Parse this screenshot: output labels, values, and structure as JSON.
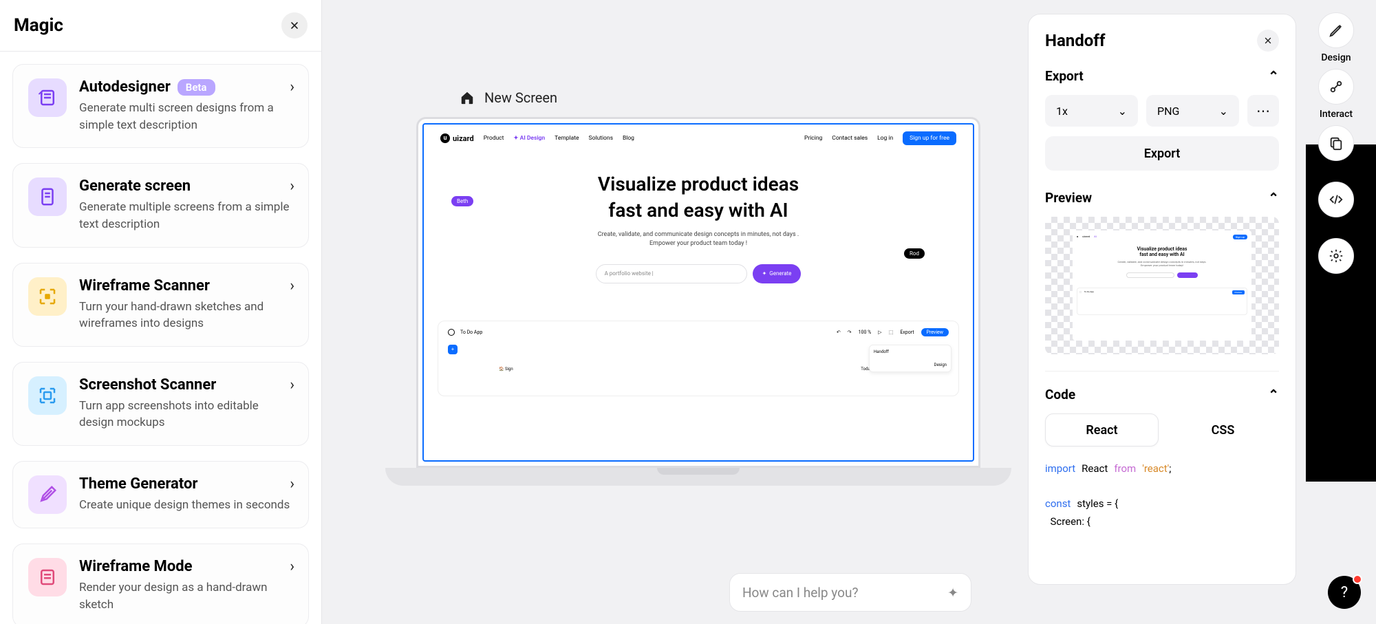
{
  "left_panel": {
    "title": "Magic",
    "cards": [
      {
        "title": "Autodesigner",
        "badge": "Beta",
        "desc": "Generate multi screen designs from a simple text description"
      },
      {
        "title": "Generate screen",
        "badge": null,
        "desc": "Generate multiple screens from a simple text description"
      },
      {
        "title": "Wireframe Scanner",
        "badge": null,
        "desc": "Turn your hand-drawn sketches and wireframes into designs"
      },
      {
        "title": "Screenshot Scanner",
        "badge": null,
        "desc": "Turn app screenshots into editable design mockups"
      },
      {
        "title": "Theme Generator",
        "badge": null,
        "desc": "Create unique design themes in seconds"
      },
      {
        "title": "Wireframe Mode",
        "badge": null,
        "desc": "Render your design as a hand-drawn sketch"
      }
    ]
  },
  "canvas": {
    "breadcrumb_label": "New Screen",
    "website": {
      "logo_text": "uizard",
      "nav": {
        "product": "Product",
        "ai_design": "✦ AI Design",
        "template": "Template",
        "solutions": "Solutions",
        "blog": "Blog"
      },
      "right_nav": {
        "pricing": "Pricing",
        "contact": "Contact sales",
        "login": "Log in",
        "signup": "Sign up for free"
      },
      "hero_line1": "Visualize product ideas",
      "hero_line2": "fast and easy with AI",
      "sub1": "Create, validate, and communicate design concepts in minutes, not days .",
      "sub2": "Empower your product team today !",
      "pill_beth": "Beth",
      "pill_rod": "Rod",
      "input_placeholder": "A portfolio website |",
      "generate_label": "Generate",
      "mock_bottom": {
        "app_title": "To Do App",
        "zoom": "100 %",
        "export": "Export",
        "preview": "Preview",
        "handoff": "Handoff",
        "design": "Design",
        "sign": "Sign",
        "today": "Today( Default List )"
      }
    }
  },
  "handoff": {
    "title": "Handoff",
    "export_heading": "Export",
    "scale": "1x",
    "format": "PNG",
    "export_button": "Export",
    "preview_heading": "Preview",
    "code_heading": "Code",
    "tabs": {
      "react": "React",
      "css": "CSS"
    },
    "code_lines": {
      "l1a": "import",
      "l1b": "React",
      "l1c": "from",
      "l1d": "'react'",
      "l1e": ";",
      "l2a": "const",
      "l2b": "styles = {",
      "l3": "  Screen: {"
    }
  },
  "rail": {
    "design": "Design",
    "interact": "Interact",
    "screens": "Screens",
    "handoff": "Handoff",
    "settings": "Settings"
  },
  "chat_placeholder": "How can I help you?",
  "help_label": "?"
}
